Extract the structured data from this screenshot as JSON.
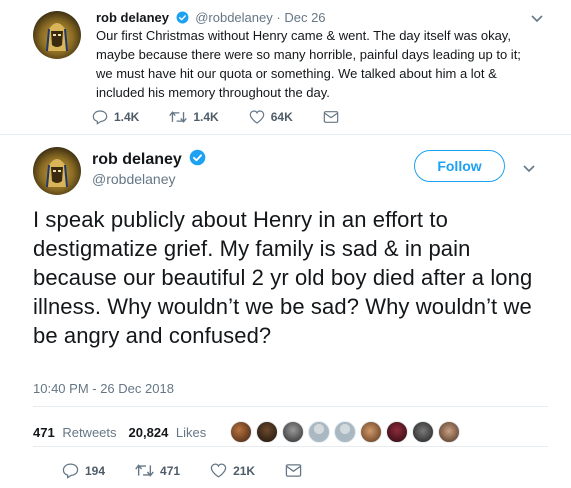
{
  "tweet1": {
    "author_name": "rob delaney",
    "handle": "@robdelaney",
    "separator": "·",
    "date": "Dec 26",
    "text": "Our first Christmas without Henry came & went. The day itself was okay, maybe because there were so many horrible, painful days leading up to it; we must have hit our quota or something. We talked about him a lot & included his memory throughout the day.",
    "replies": "1.4K",
    "retweets": "1.4K",
    "likes": "64K"
  },
  "tweet2": {
    "author_name": "rob delaney",
    "handle": "@robdelaney",
    "follow_label": "Follow",
    "text": "I speak publicly about Henry in an effort to destigmatize grief. My family is sad & in pain because our beautiful 2 yr old boy died after a long illness. Why wouldn’t we be sad? Why wouldn’t we be angry and confused?",
    "timestamp": "10:40 PM - 26 Dec 2018",
    "retweets_count": "471",
    "retweets_label": "Retweets",
    "likes_count": "20,824",
    "likes_label": "Likes",
    "replies": "194",
    "retweets": "471",
    "likes": "21K"
  },
  "colors": {
    "accent": "#1da1f2",
    "muted": "#657786",
    "text": "#14171a"
  },
  "liker_avatars": [
    "liker-1",
    "liker-2",
    "liker-3",
    "liker-4",
    "liker-5",
    "liker-6",
    "liker-7",
    "liker-8",
    "liker-9",
    "liker-10"
  ]
}
